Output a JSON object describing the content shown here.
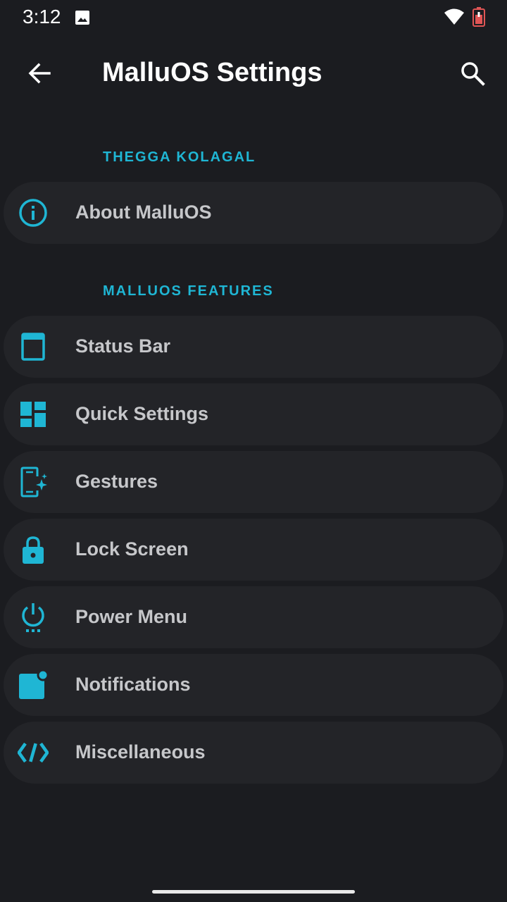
{
  "status_bar": {
    "time": "3:12",
    "icons": [
      "image-icon",
      "wifi-icon",
      "battery-icon"
    ],
    "battery_color": "#e05555"
  },
  "toolbar": {
    "title": "MalluOS Settings",
    "back_icon": "arrow-back-icon",
    "search_icon": "search-icon"
  },
  "accent_color": "#1fb6d4",
  "sections": [
    {
      "header": "THEGGA KOLAGAL",
      "items": [
        {
          "label": "About MalluOS",
          "icon": "info-icon"
        }
      ]
    },
    {
      "header": "MALLUOS FEATURES",
      "items": [
        {
          "label": "Status Bar",
          "icon": "status-bar-icon"
        },
        {
          "label": "Quick Settings",
          "icon": "dashboard-icon"
        },
        {
          "label": "Gestures",
          "icon": "phone-gesture-icon"
        },
        {
          "label": "Lock Screen",
          "icon": "lock-icon"
        },
        {
          "label": "Power Menu",
          "icon": "power-icon"
        },
        {
          "label": "Notifications",
          "icon": "notification-dot-icon"
        },
        {
          "label": "Miscellaneous",
          "icon": "code-icon"
        }
      ]
    }
  ]
}
